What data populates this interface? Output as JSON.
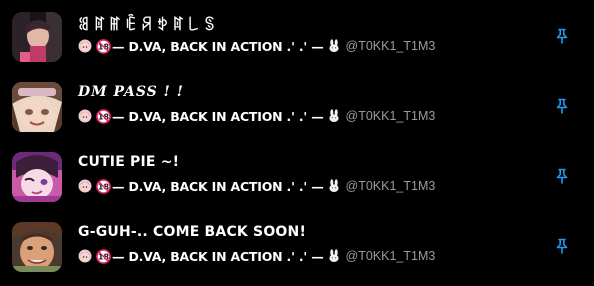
{
  "rows": [
    {
      "title": "ꌃꍏꂵꍟꋪꉣꍏ꒒ꌗ",
      "status": "— D.VA, BACK IN ACTION .' .' —",
      "handle": "@T0KK1_T1M3",
      "avatar": "gamerpals-avatar"
    },
    {
      "title": "DM PASS ! !",
      "status": "— D.VA, BACK IN ACTION .' .' —",
      "handle": "@T0KK1_T1M3",
      "avatar": "dm-pass-avatar"
    },
    {
      "title": "CUTIE PIE ~!",
      "status": "— D.VA, BACK IN ACTION .' .' —",
      "handle": "@T0KK1_T1M3",
      "avatar": "cutie-pie-avatar"
    },
    {
      "title": "G-GUH-.. COME BACK SOON!",
      "status": "— D.VA, BACK IN ACTION .' .' —",
      "handle": "@T0KK1_T1M3",
      "avatar": "g-guh-avatar"
    }
  ],
  "icons": {
    "pin": "pin-icon",
    "status_emoji_1": "dva-emoji-icon",
    "status_emoji_2": "eighteen-emoji-icon",
    "status_emoji_3": "bunny-emoji-icon"
  },
  "colors": {
    "background": "#000000",
    "text": "#ffffff",
    "handle": "#9b9b9b",
    "pin": "#1d9bf0",
    "eighteen_badge": "#e0245e"
  }
}
